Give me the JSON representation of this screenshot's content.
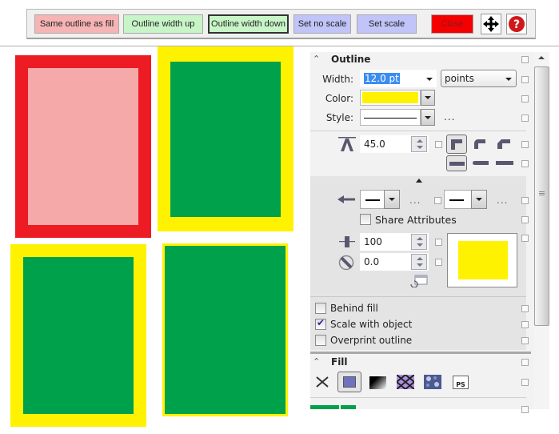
{
  "toolbar": {
    "buttons": [
      {
        "label": "Same outline as fill",
        "color": "#f7b4b4"
      },
      {
        "label": "Outline width up",
        "color": "#c8f5c8"
      },
      {
        "label": "Outline width down",
        "color": "#c8f5c8"
      },
      {
        "label": "Set no scale",
        "color": "#c0c4f8"
      },
      {
        "label": "Set scale",
        "color": "#c0c4f8"
      },
      {
        "label": "Close",
        "color": "#f50000"
      }
    ],
    "move_icon": "move-arrows-icon",
    "help_icon": "help-question-icon"
  },
  "canvas": {
    "shapes": [
      {
        "name": "rectangle-1",
        "outline_color": "#ed1c24",
        "fill_color": "#f5a9a9"
      },
      {
        "name": "rectangle-2",
        "outline_color": "#fff200",
        "fill_color": "#00a14b"
      },
      {
        "name": "rectangle-3",
        "outline_color": "#fff200",
        "fill_color": "#00a14b"
      },
      {
        "name": "rectangle-4",
        "outline_color": "#fff200",
        "fill_color": "#00a14b"
      }
    ]
  },
  "outline": {
    "title": "Outline",
    "width_label": "Width:",
    "width_value": "12.0 pt",
    "units_value": "points",
    "color_label": "Color:",
    "color_value": "#fff200",
    "style_label": "Style:",
    "style_more": "...",
    "miter_value": "45.0",
    "start_more": "...",
    "end_more": "...",
    "share_attributes": "Share Attributes",
    "stretch_value": "100",
    "angle_value": "0.0",
    "behind_fill": "Behind fill",
    "scale_with_object": "Scale with object",
    "overprint_outline": "Overprint outline",
    "behind_fill_checked": false,
    "scale_with_object_checked": true,
    "overprint_outline_checked": false,
    "share_attributes_checked": false
  },
  "fill": {
    "title": "Fill",
    "types": [
      "no-fill",
      "uniform-fill",
      "fountain-fill",
      "pattern-fill",
      "texture-fill",
      "postscript-fill"
    ],
    "postscript_label": "PS",
    "current_color": "#00a14b"
  }
}
